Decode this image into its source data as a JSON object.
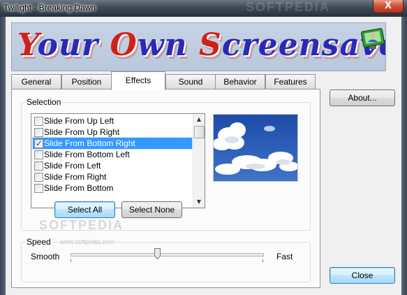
{
  "window": {
    "title": "Twilight -  Breaking Dawn",
    "close_glyph": "X"
  },
  "banner": {
    "part1": "Your ",
    "part1_initial": "Y",
    "own_initial": "O",
    "own_rest": "wn ",
    "screensaver_initial": "S",
    "screensaver_rest": "creensaver",
    "icon": "monitor-person-icon"
  },
  "tabs": [
    {
      "label": "General"
    },
    {
      "label": "Position"
    },
    {
      "label": "Effects",
      "active": true
    },
    {
      "label": "Sound"
    },
    {
      "label": "Behavior"
    },
    {
      "label": "Features"
    }
  ],
  "selection": {
    "label": "Selection",
    "items": [
      {
        "label": "Slide From Up Left",
        "checked": false
      },
      {
        "label": "Slide From Up Right",
        "checked": false
      },
      {
        "label": "Slide From Bottom Right",
        "checked": true,
        "selected": true
      },
      {
        "label": "Slide From Bottom Left",
        "checked": false
      },
      {
        "label": "Slide From Left",
        "checked": false
      },
      {
        "label": "Slide From Right",
        "checked": false
      },
      {
        "label": "Slide From Bottom",
        "checked": false
      }
    ],
    "select_all": "Select All",
    "select_none": "Select None"
  },
  "speed": {
    "label": "Speed",
    "min_label": "Smooth",
    "max_label": "Fast",
    "value_fraction": 0.45
  },
  "buttons": {
    "about": "About...",
    "close": "Close"
  },
  "watermark": {
    "top": "SOFTPEDIA",
    "main": "SOFTPEDIA",
    "url": "www.softpedia.com"
  },
  "colors": {
    "selection_highlight": "#3399ff",
    "banner_text": "#2a2ab6",
    "banner_accent": "#d0201a"
  }
}
